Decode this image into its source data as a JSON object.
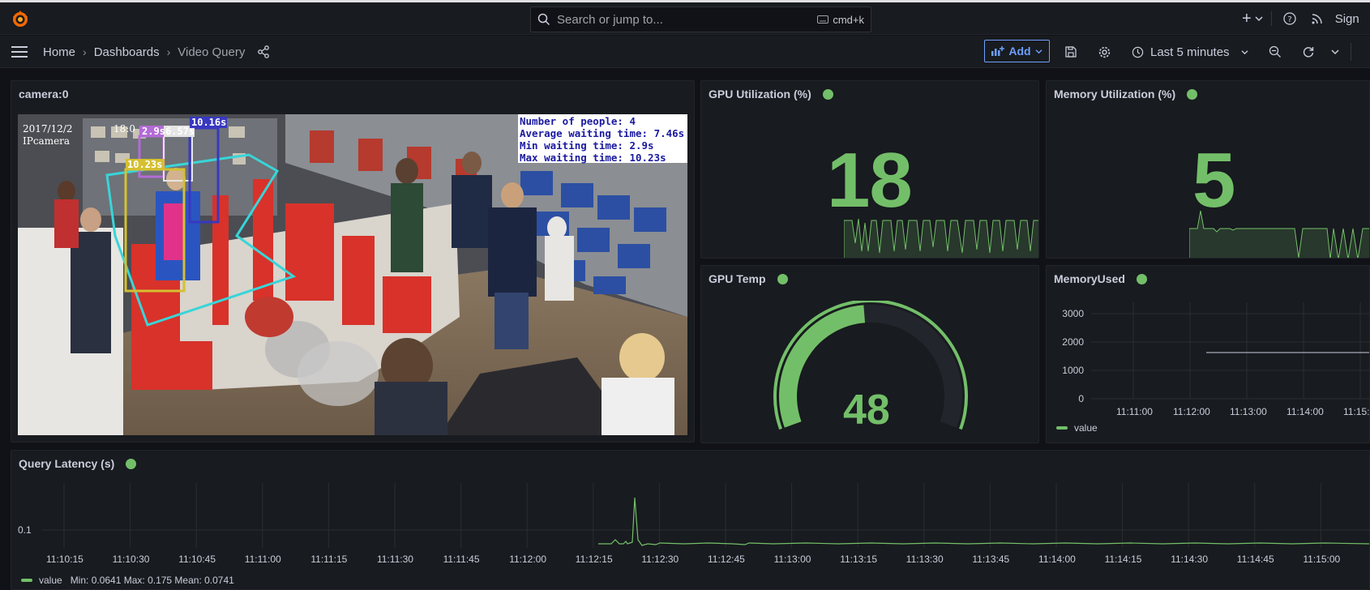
{
  "topbar": {
    "search_placeholder": "Search or jump to...",
    "search_shortcut": "cmd+k",
    "plus_label": "+",
    "signin_label": "Sign"
  },
  "navbar": {
    "breadcrumbs": [
      "Home",
      "Dashboards",
      "Video Query"
    ],
    "add_label": "Add",
    "time_range": "Last 5 minutes"
  },
  "panels": {
    "camera": {
      "title": "camera:0",
      "video_timestamp": "2017/12/2",
      "video_timestamp_tail": "18:0",
      "video_camera": "IPcamera",
      "overlay_lines": [
        "Number of people: 4",
        "Average waiting time: 7.46s",
        "Min waiting time: 2.9s",
        "Max waiting time: 10.23s"
      ],
      "boxes": [
        "2.9s",
        "6.57s",
        "10.16s",
        "10.23s"
      ]
    },
    "gpu_util": {
      "title": "GPU Utilization (%)",
      "value": "18"
    },
    "mem_util": {
      "title": "Memory Utilization (%)",
      "value": "5"
    },
    "gpu_temp": {
      "title": "GPU Temp",
      "value": "48",
      "gauge_fraction": 0.48
    },
    "mem_used": {
      "title": "MemoryUsed",
      "y_ticks": [
        "3000",
        "2000",
        "1000",
        "0"
      ],
      "x_ticks": [
        "11:11:00",
        "11:12:00",
        "11:13:00",
        "11:14:00",
        "11:15:"
      ],
      "legend": "value",
      "series_value": 1650
    },
    "latency": {
      "title": "Query Latency (s)",
      "y_tick": "0.1",
      "x_ticks": [
        "11:10:15",
        "11:10:30",
        "11:10:45",
        "11:11:00",
        "11:11:15",
        "11:11:30",
        "11:11:45",
        "11:12:00",
        "11:12:15",
        "11:12:30",
        "11:12:45",
        "11:13:00",
        "11:13:15",
        "11:13:30",
        "11:13:45",
        "11:14:00",
        "11:14:15",
        "11:14:30",
        "11:14:45",
        "11:15:00"
      ],
      "legend": "value",
      "stats": "Min: 0.0641  Max: 0.175  Mean: 0.0741"
    }
  },
  "colors": {
    "accent": "#6e9fff",
    "green": "#73bf69",
    "panel": "#181b1f",
    "bg": "#111217"
  }
}
